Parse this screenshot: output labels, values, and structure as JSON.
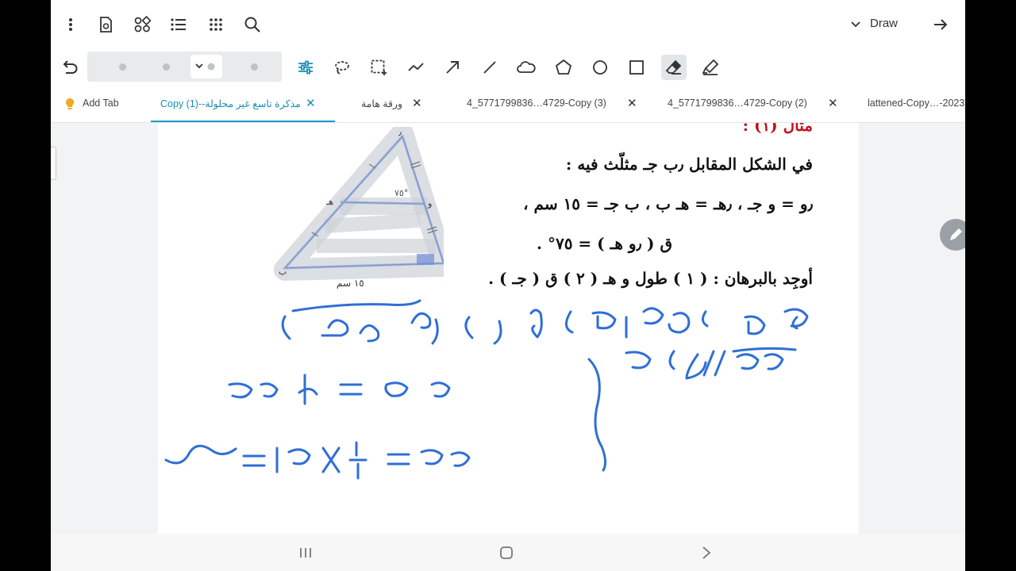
{
  "toolbar": {
    "draw_label": "Draw",
    "icons": [
      "more-vert-icon",
      "page-settings-icon",
      "shapes-icon",
      "list-icon",
      "apps-grid-icon",
      "search-icon",
      "undo-icon",
      "chevron-down-icon",
      "forward-arrow-icon"
    ],
    "tools": [
      "adjust-icon",
      "lasso-icon",
      "select-rect-icon",
      "polyline-icon",
      "arrow-tool-icon",
      "line-tool-icon",
      "cloud-shape-icon",
      "pentagon-shape-icon",
      "circle-shape-icon",
      "square-shape-icon",
      "eraser-icon",
      "highlighter-icon"
    ],
    "active_tool": "eraser-icon"
  },
  "tabs": [
    {
      "label": "Add Tab"
    },
    {
      "label": "Copy (1)--مذكرة تاسع غير محلولة"
    },
    {
      "label": "ورقة هامة"
    },
    {
      "label": "4_5771799836…4729-Copy (3)"
    },
    {
      "label": "4_5771799836…4729-Copy (2)"
    },
    {
      "label": "lattened-Copy…-2023"
    }
  ],
  "document": {
    "heading": "مثال (١) :",
    "line1": "في الشكل المقابل ٫ب جـ  مثلّث فيه :",
    "line2": "٫و = و جـ ، ٫هـ = هـ ب ، ب جـ = ١٥ سم ،",
    "line3": "ق ( ٫و هـ ) = ٧٥° .",
    "line4": "أوجِد بالبرهان : ( ١ ) طول و هـ   ( ٢ ) ق ( جـ ) .",
    "figure": {
      "angle": "٧٥°",
      "base_label": "١٥ سم",
      "vertex_top": "٫",
      "vertex_left": "ب",
      "vertex_right": "جـ",
      "point_left": "هـ",
      "point_right": "و"
    }
  },
  "colors": {
    "accent": "#1a9bc8",
    "ink": "#2f6fd6",
    "heading_red": "#c0141d",
    "page": "#ffffff",
    "canvas": "#f1f3f4"
  }
}
